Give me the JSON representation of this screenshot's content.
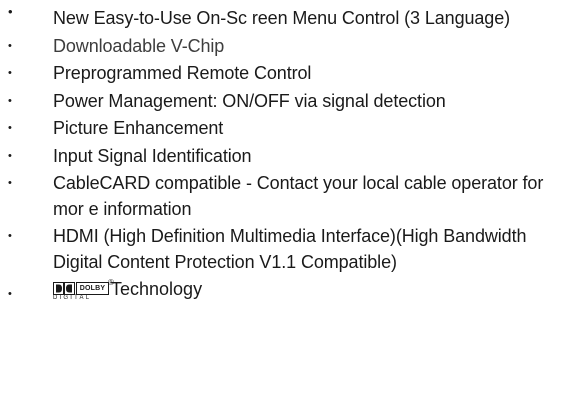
{
  "features": [
    {
      "text": "New Easy-to-Use On-Sc reen Menu Control (3 Language)",
      "bullet": "•"
    },
    {
      "text": "Downloadable V-Chip",
      "bullet": "•"
    },
    {
      "text": "Preprogrammed Remote Control",
      "bullet": "•"
    },
    {
      "text": "Power Management:  ON/OFF via signal detection",
      "bullet": "•"
    },
    {
      "text": "Picture Enhancement",
      "bullet": "•"
    },
    {
      "text": "Input Signal Identification",
      "bullet": "•"
    },
    {
      "text": "CableCARD compatible -  Contact your local cable operator for mor e information",
      "bullet": "•"
    },
    {
      "text": "HDMI (High Definition Multimedia Interface)(High Bandwidth Digital Content  Protection V1.1 Compatible)",
      "bullet": "•"
    }
  ],
  "dolby_item": {
    "bullet": "•",
    "logo_box_text": "DOLBY",
    "logo_sub_text": "DIGITAL",
    "registered_mark": "®",
    "text": "Technology"
  }
}
